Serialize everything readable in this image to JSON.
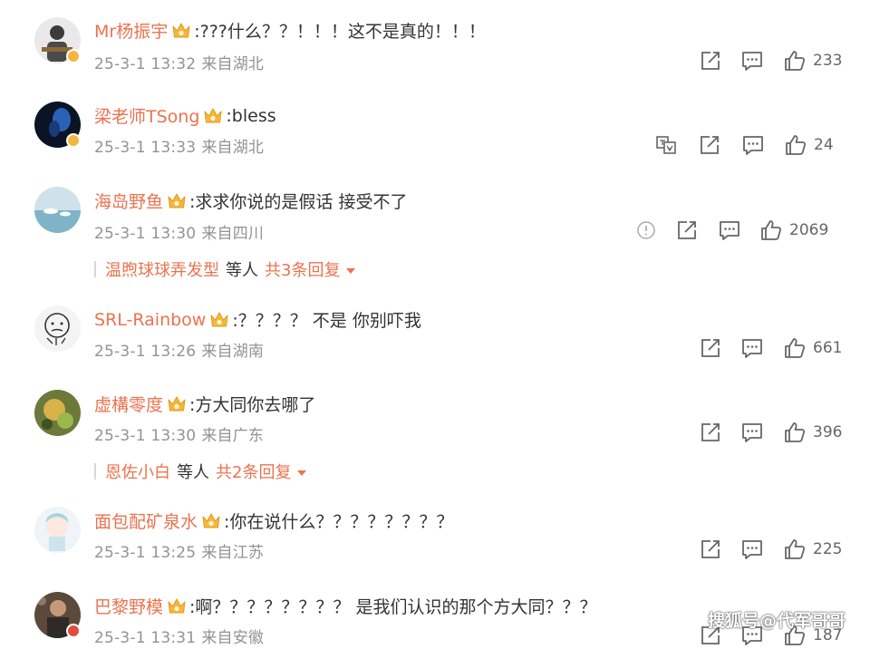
{
  "comments": [
    {
      "user": "Mr杨振宇",
      "text": ":???什么？？！！！这不是真的！！！",
      "time": "25-3-1 13:32",
      "location": "来自湖北",
      "likes": "233"
    },
    {
      "user": "梁老师TSong",
      "text": ":bless",
      "time": "25-3-1 13:33",
      "location": "来自湖北",
      "likes": "24"
    },
    {
      "user": "海岛野鱼",
      "text": ":求求你说的是假话 接受不了",
      "time": "25-3-1 13:30",
      "location": "来自四川",
      "likes": "2069",
      "reply_preview": {
        "name": "温煦球球弄发型",
        "others": "等人",
        "total": "共3条回复"
      }
    },
    {
      "user": "SRL-Rainbow",
      "text": ":？？？？ 不是 你别吓我",
      "time": "25-3-1 13:26",
      "location": "来自湖南",
      "likes": "661"
    },
    {
      "user": "虚構零度",
      "text": ":方大同你去哪了",
      "time": "25-3-1 13:30",
      "location": "来自广东",
      "likes": "396",
      "reply_preview": {
        "name": "恩佐小白",
        "others": "等人",
        "total": "共2条回复"
      }
    },
    {
      "user": "面包配矿泉水",
      "text": ":你在说什么？？？？？？？？",
      "time": "25-3-1 13:25",
      "location": "来自江苏",
      "likes": "225"
    },
    {
      "user": "巴黎野模",
      "text": ":啊？？？？？？？？ 是我们认识的那个方大同？？？",
      "time": "25-3-1 13:31",
      "location": "来自安徽",
      "likes": "187"
    }
  ],
  "watermark": "搜狐号@代军哥哥",
  "icons": {
    "share": "share-icon",
    "comment": "comment-icon",
    "like": "thumbs-up-icon",
    "translate": "translate-icon",
    "report": "report-icon",
    "crown": "crown-badge-icon"
  },
  "colors": {
    "username": "#eb7350",
    "text": "#333333",
    "meta": "#939393",
    "icon": "#666666"
  }
}
